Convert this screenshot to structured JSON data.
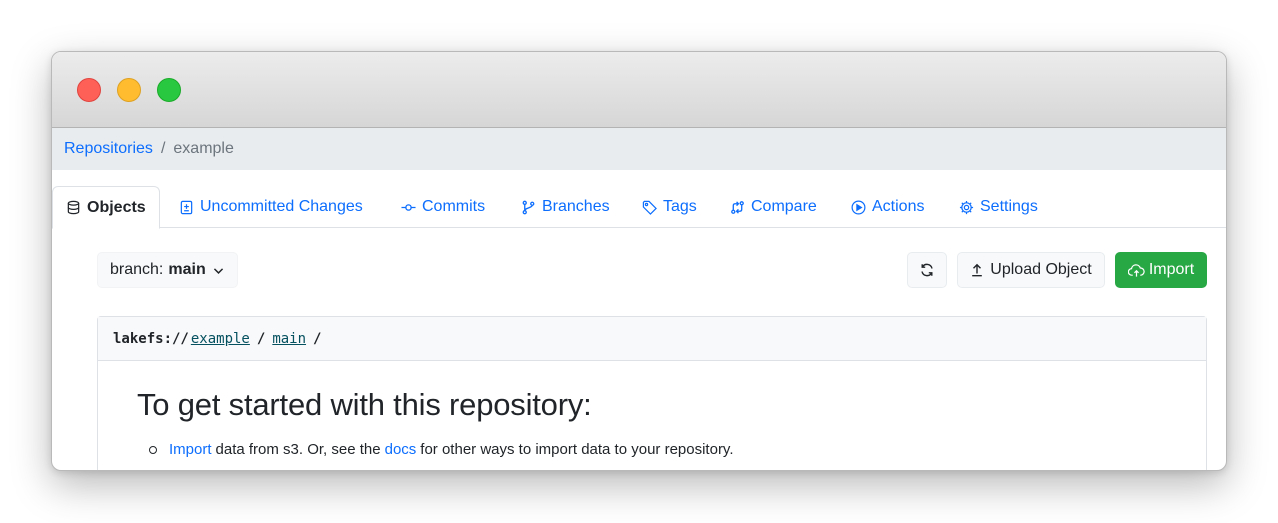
{
  "breadcrumb": {
    "root": "Repositories",
    "separator": "/",
    "current": "example"
  },
  "tabs": [
    {
      "label": "Objects",
      "icon": "database-icon",
      "active": true
    },
    {
      "label": "Uncommitted Changes",
      "icon": "file-diff-icon"
    },
    {
      "label": "Commits",
      "icon": "git-commit-icon"
    },
    {
      "label": "Branches",
      "icon": "git-branch-icon"
    },
    {
      "label": "Tags",
      "icon": "tag-icon"
    },
    {
      "label": "Compare",
      "icon": "git-compare-icon"
    },
    {
      "label": "Actions",
      "icon": "play-icon"
    },
    {
      "label": "Settings",
      "icon": "gear-icon"
    }
  ],
  "toolbar": {
    "branch_prefix": "branch:",
    "branch_name": "main",
    "upload_label": "Upload Object",
    "import_label": "Import"
  },
  "path": {
    "protocol": "lakefs://",
    "repo": "example",
    "branch": "main",
    "separator": "/"
  },
  "getting_started": {
    "heading": "To get started with this repository:",
    "item1_link1": "Import",
    "item1_text1": "data from s3. Or, see the",
    "item1_link2": "docs",
    "item1_text2": "for other ways to import data to your repository."
  },
  "colors": {
    "link": "#0d6efd",
    "import_button": "#28a745",
    "breadcrumb_bg": "#e9ecef"
  }
}
